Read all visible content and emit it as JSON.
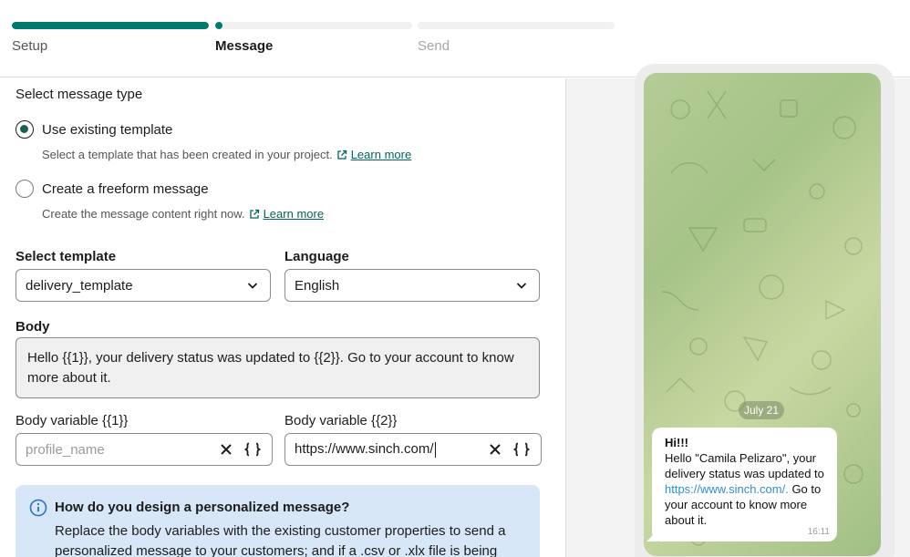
{
  "stepper": {
    "steps": [
      {
        "label": "Setup",
        "state": "complete",
        "progress": 1.0
      },
      {
        "label": "Message",
        "state": "active",
        "progress": 0.0
      },
      {
        "label": "Send",
        "state": "upcoming",
        "progress": 0.0
      }
    ]
  },
  "message_type": {
    "label": "Select message type",
    "options": [
      {
        "title": "Use existing template",
        "description": "Select a template that has been created in your project.",
        "link": "Learn more",
        "selected": true
      },
      {
        "title": "Create a freeform message",
        "description": "Create the message content right now.",
        "link": "Learn more",
        "selected": false
      }
    ]
  },
  "template": {
    "label": "Select template",
    "value": "delivery_template"
  },
  "language": {
    "label": "Language",
    "value": "English"
  },
  "body": {
    "label": "Body",
    "text": "Hello {{1}}, your delivery status was updated to {{2}}. Go to your account to know more about it."
  },
  "variables": [
    {
      "label": "Body variable {{1}}",
      "value": "",
      "placeholder": "profile_name"
    },
    {
      "label": "Body variable {{2}}",
      "value": "https://www.sinch.com/",
      "placeholder": ""
    }
  ],
  "info": {
    "title": "How do you design a personalized message?",
    "text": "Replace the body variables with the existing customer properties to send a personalized message to your customers; and if a .csv or .xlx file is being"
  },
  "preview": {
    "date": "July 21",
    "greeting": "Hi!!!",
    "message_before_link": "Hello \"Camila Pelizaro\", your delivery status was updated to ",
    "link": "https://www.sinch.com/.",
    "message_after_link": " Go to your account to know more about it.",
    "time": "16:11"
  },
  "colors": {
    "accent": "#007a6e",
    "info_bg": "#d7e7f8",
    "link": "#00655a"
  }
}
